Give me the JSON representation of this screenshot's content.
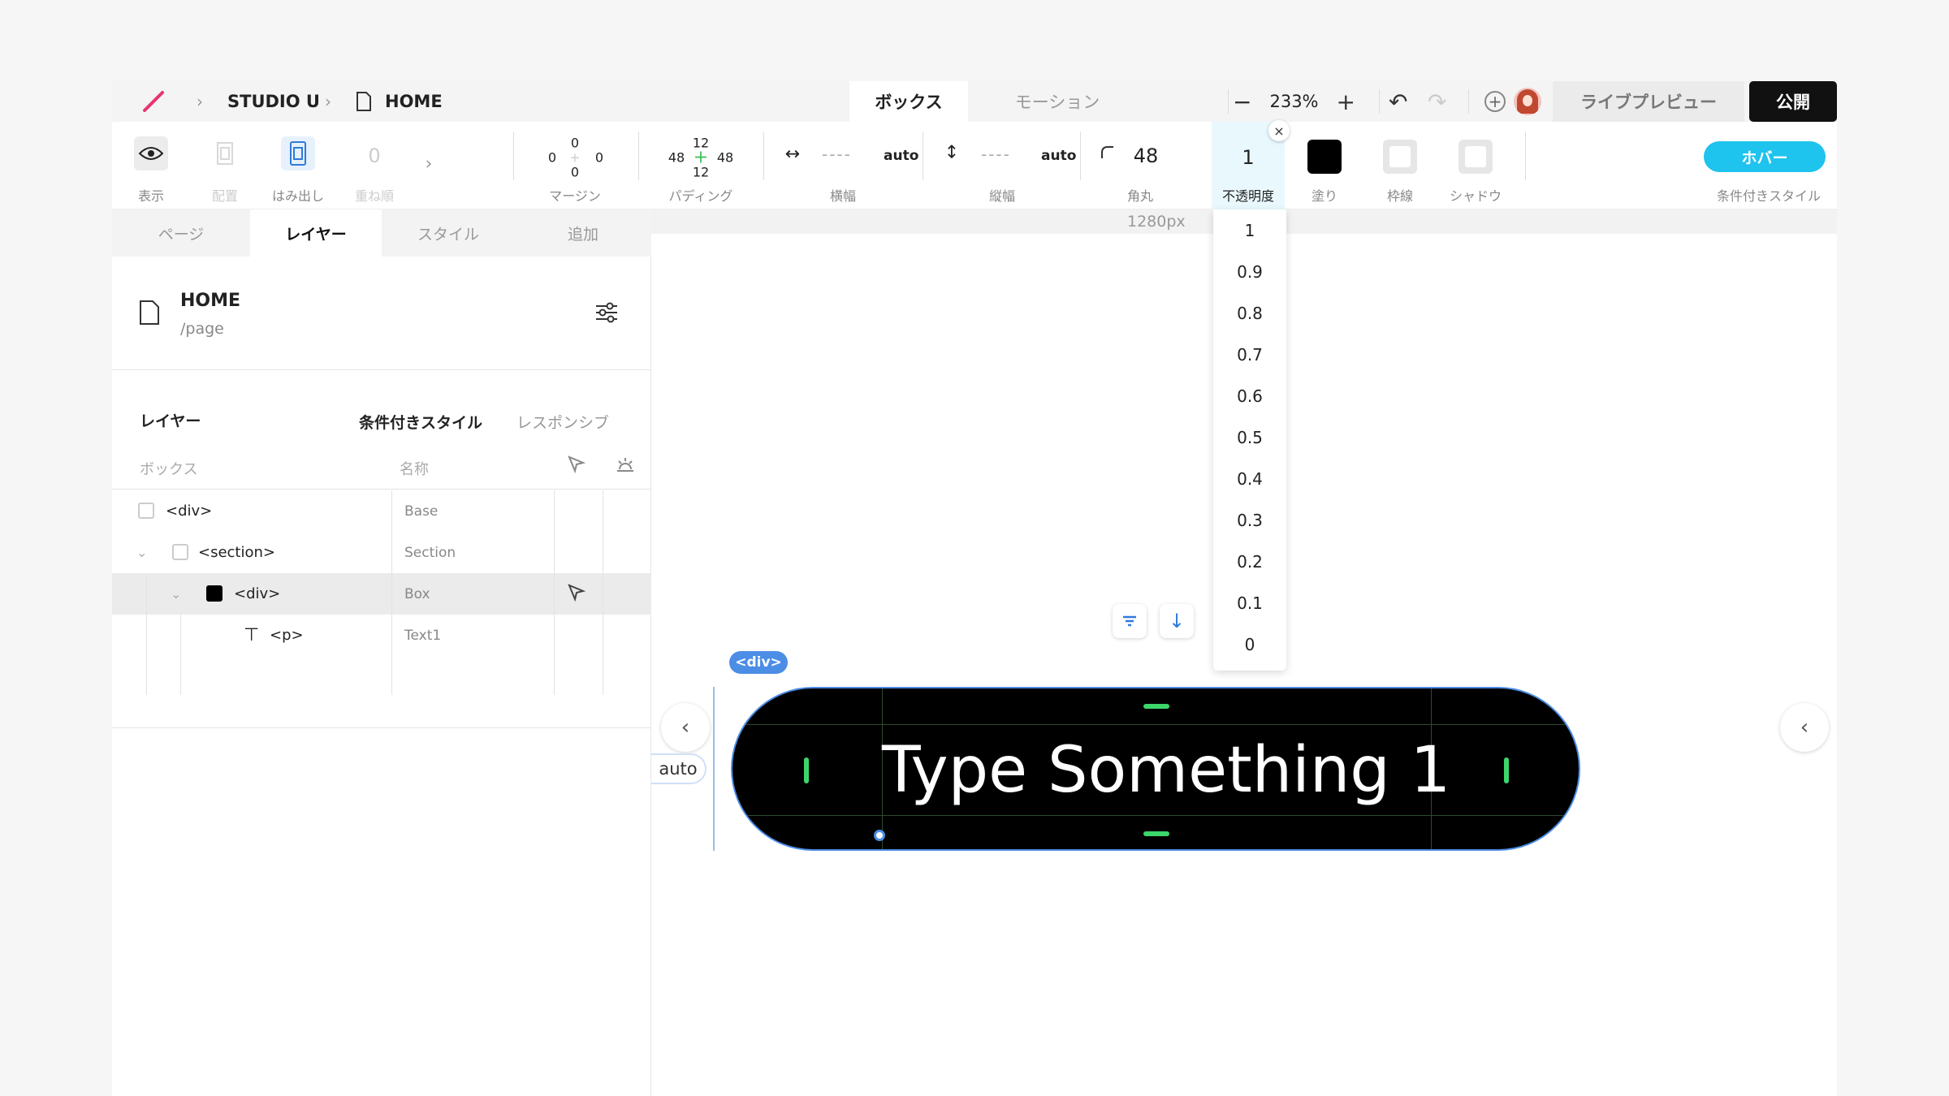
{
  "topbar": {
    "project": "STUDIO U",
    "page": "HOME",
    "tabs": {
      "box": "ボックス",
      "motion": "モーション"
    },
    "zoom_level": "233%",
    "live_preview": "ライブプレビュー",
    "publish": "公開"
  },
  "toolbar": {
    "show_label": "表示",
    "layout_label": "配置",
    "overflow_label": "はみ出し",
    "overlap_label": "重ね順",
    "overlap_value": "0",
    "margin_label": "マージン",
    "margin": {
      "top": "0",
      "right": "0",
      "bottom": "0",
      "left": "0"
    },
    "padding_label": "パディング",
    "padding": {
      "top": "12",
      "right": "48",
      "bottom": "12",
      "left": "48"
    },
    "width_label": "横幅",
    "width_value": "----",
    "width_unit": "auto",
    "height_label": "縦幅",
    "height_value": "----",
    "height_unit": "auto",
    "radius_label": "角丸",
    "radius_value": "48",
    "opacity_label": "不透明度",
    "opacity_value": "1",
    "fill_label": "塗り",
    "border_label": "枠線",
    "shadow_label": "シャドウ",
    "hover_button": "ホバー",
    "conditional_label": "条件付きスタイル",
    "colors": {
      "fill": "#000000",
      "accent": "#1ec3ee"
    }
  },
  "left_panel": {
    "tabs": [
      "ページ",
      "レイヤー",
      "スタイル",
      "追加"
    ],
    "active_tab": "レイヤー",
    "page_title": "HOME",
    "page_path": "/page",
    "layers_heading": "レイヤー",
    "conditional_tab": "条件付きスタイル",
    "responsive_tab": "レスポンシブ",
    "col_box": "ボックス",
    "col_name": "名称",
    "layers": [
      {
        "tag": "<div>",
        "name": "Base"
      },
      {
        "tag": "<section>",
        "name": "Section"
      },
      {
        "tag": "<div>",
        "name": "Box"
      },
      {
        "tag": "<p>",
        "name": "Text1"
      }
    ]
  },
  "canvas": {
    "ruler_label": "1280px",
    "selected_tag": "<div>",
    "text": "Type Something 1",
    "auto_label": "auto",
    "opacity_options": [
      "1",
      "0.9",
      "0.8",
      "0.7",
      "0.6",
      "0.5",
      "0.4",
      "0.3",
      "0.2",
      "0.1",
      "0"
    ]
  }
}
